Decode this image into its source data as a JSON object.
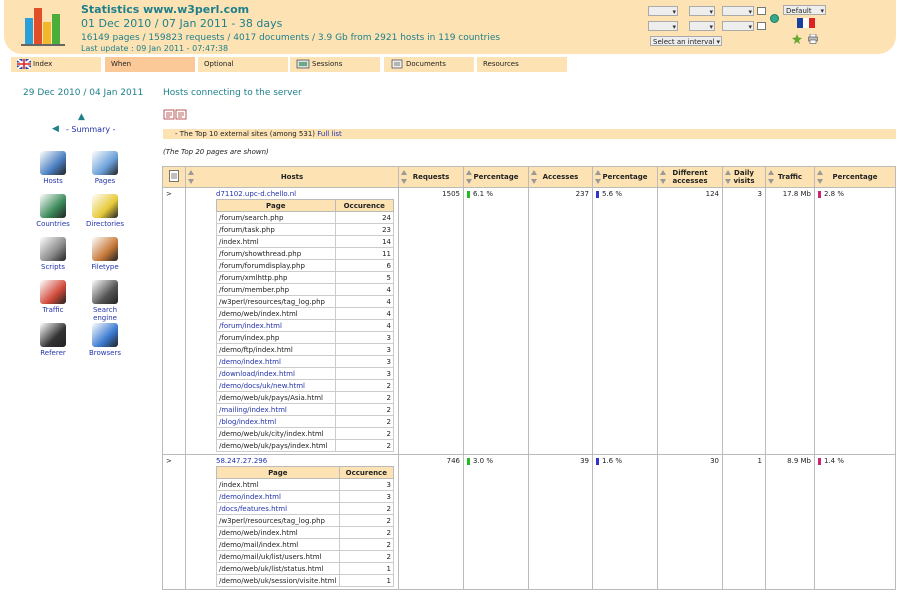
{
  "header": {
    "title": "Statistics www.w3perl.com",
    "period": "01 Dec 2010 / 07 Jan 2011",
    "days": " - 38 days",
    "summary": "16149 pages / 159823 requests / 4017 documents / 3.9 Gb from 2921 hosts in 119 countries",
    "last_update": "Last update : 09 Jan 2011 - 07:47:38",
    "interval_label": "Select an interval",
    "default_label": "Default",
    "colors": {
      "bg": "#fde3b3",
      "title": "#1e7f8c"
    }
  },
  "tabs": [
    {
      "label": "Index",
      "icon": "uk-flag-icon"
    },
    {
      "label": "When",
      "active": true
    },
    {
      "label": "Optional"
    },
    {
      "label": "Sessions",
      "icon": "sessions-icon"
    },
    {
      "label": "Documents",
      "icon": "documents-icon"
    },
    {
      "label": "Resources"
    }
  ],
  "sidebar": {
    "daterange": "29 Dec 2010 / 04 Jan 2011",
    "summary": "- Summary -",
    "items": [
      {
        "label": "Hosts",
        "icon": "hosts-icon"
      },
      {
        "label": "Pages",
        "icon": "pages-icon"
      },
      {
        "label": "Countries",
        "icon": "countries-icon"
      },
      {
        "label": "Directories",
        "icon": "directories-icon"
      },
      {
        "label": "Scripts",
        "icon": "scripts-icon"
      },
      {
        "label": "Filetype",
        "icon": "filetype-icon"
      },
      {
        "label": "Traffic",
        "icon": "traffic-icon"
      },
      {
        "label": "Search engine",
        "icon": "search-engine-icon"
      },
      {
        "label": "Referer",
        "icon": "referer-icon"
      },
      {
        "label": "Browsers",
        "icon": "browsers-icon"
      }
    ]
  },
  "main": {
    "title": "Hosts connecting to the server",
    "topbar_text": "- The Top 10 external sites (among 531)",
    "full_list": "Full list",
    "shown_note": "(The Top 20 pages are shown)",
    "columns": [
      "Hosts",
      "Requests",
      "Percentage",
      "Accesses",
      "Percentage",
      "Different accesses",
      "Daily visits",
      "Traffic",
      "Percentage"
    ],
    "sub_columns": [
      "Page",
      "Occurence"
    ],
    "rows": [
      {
        "marker": ">",
        "host": "d71102.upc-d.chello.nl",
        "requests": "1505",
        "req_pct": "6.1 %",
        "accesses": "237",
        "acc_pct": "5.6 %",
        "different": "124",
        "daily": "3",
        "traffic": "17.8 Mb",
        "traffic_pct": "2.8 %",
        "bars": {
          "req_color": "#22bb22",
          "acc_color": "#3333cc",
          "traffic_color": "#cc2277"
        },
        "pages": [
          [
            "/forum/search.php",
            "24",
            false
          ],
          [
            "/forum/task.php",
            "23",
            false
          ],
          [
            "/index.html",
            "14",
            false
          ],
          [
            "/forum/showthread.php",
            "11",
            false
          ],
          [
            "/forum/forumdisplay.php",
            "6",
            false
          ],
          [
            "/forum/xmlhttp.php",
            "5",
            false
          ],
          [
            "/forum/member.php",
            "4",
            false
          ],
          [
            "/w3perl/resources/tag_log.php",
            "4",
            false
          ],
          [
            "/demo/web/index.html",
            "4",
            false
          ],
          [
            "/forum/index.html",
            "4",
            true
          ],
          [
            "/forum/index.php",
            "3",
            false
          ],
          [
            "/demo/ftp/index.html",
            "3",
            false
          ],
          [
            "/demo/index.html",
            "3",
            true
          ],
          [
            "/download/index.html",
            "3",
            true
          ],
          [
            "/demo/docs/uk/new.html",
            "2",
            true
          ],
          [
            "/demo/web/uk/pays/Asia.html",
            "2",
            false
          ],
          [
            "/mailing/index.html",
            "2",
            true
          ],
          [
            "/blog/index.html",
            "2",
            true
          ],
          [
            "/demo/web/uk/city/index.html",
            "2",
            false
          ],
          [
            "/demo/web/uk/pays/index.html",
            "2",
            false
          ]
        ]
      },
      {
        "marker": ">",
        "host": "58.247.27.296",
        "requests": "746",
        "req_pct": "3.0 %",
        "accesses": "39",
        "acc_pct": "1.6 %",
        "different": "30",
        "daily": "1",
        "traffic": "8.9 Mb",
        "traffic_pct": "1.4 %",
        "bars": {
          "req_color": "#22bb22",
          "acc_color": "#3333cc",
          "traffic_color": "#cc2277"
        },
        "pages": [
          [
            "/index.html",
            "3",
            false
          ],
          [
            "/demo/index.html",
            "3",
            true
          ],
          [
            "/docs/features.html",
            "2",
            true
          ],
          [
            "/w3perl/resources/tag_log.php",
            "2",
            false
          ],
          [
            "/demo/web/index.html",
            "2",
            false
          ],
          [
            "/demo/mail/index.html",
            "2",
            false
          ],
          [
            "/demo/mail/uk/list/users.html",
            "2",
            false
          ],
          [
            "/demo/web/uk/list/status.html",
            "1",
            false
          ],
          [
            "/demo/web/uk/session/visite.html",
            "1",
            false
          ]
        ]
      }
    ]
  }
}
